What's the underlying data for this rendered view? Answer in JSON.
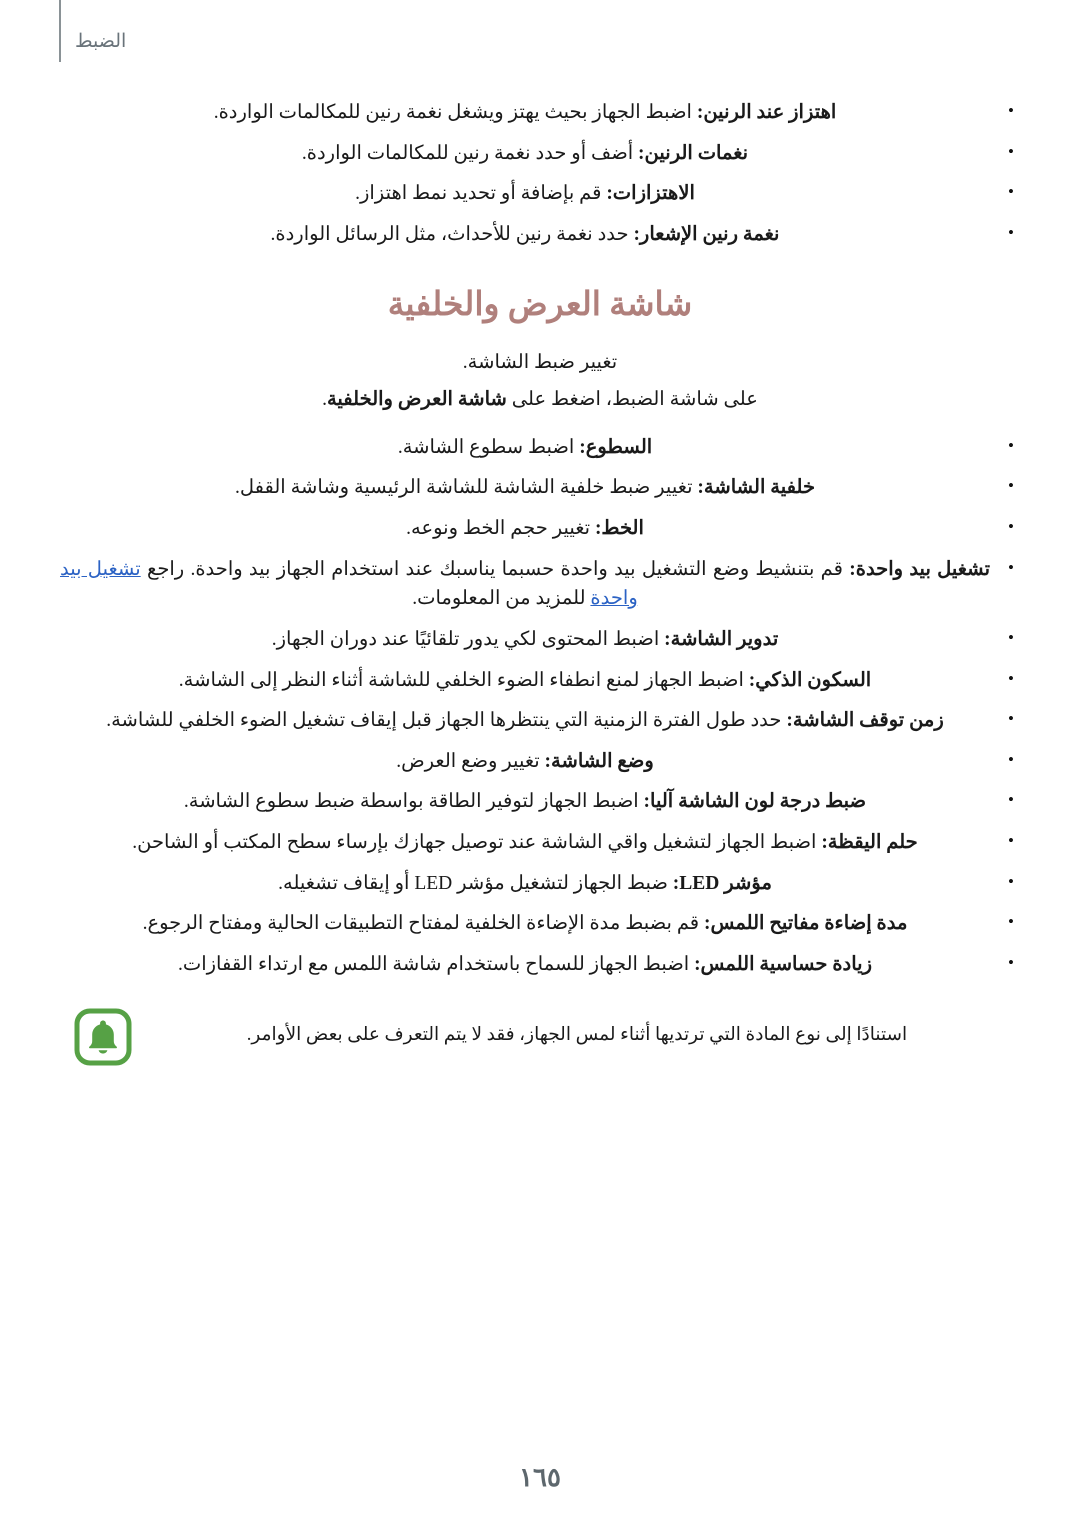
{
  "header": {
    "title": "الضبط",
    "rule_color": "#8a9296",
    "title_color": "#69737a"
  },
  "colors": {
    "heading": "#b0807c",
    "link": "#2b62c4",
    "note_icon": "#56a145",
    "body_text": "#1a1a1a",
    "page_number": "#5d676d"
  },
  "top_list": {
    "items": [
      {
        "term": "اهتزاز عند الرنين:",
        "description": " اضبط الجهاز بحيث يهتز ويشغل نغمة رنين للمكالمات الواردة."
      },
      {
        "term": "نغمات الرنين:",
        "description": " أضف أو حدد نغمة رنين للمكالمات الواردة."
      },
      {
        "term": "الاهتزازات:",
        "description": " قم بإضافة أو تحديد نمط اهتزاز."
      },
      {
        "term": "نغمة رنين الإشعار:",
        "description": " حدد نغمة رنين للأحداث، مثل الرسائل الواردة."
      }
    ]
  },
  "section": {
    "heading": "شاشة العرض والخلفية",
    "intro": "تغيير ضبط الشاشة.",
    "nav_prefix": "على شاشة الضبط، اضغط على ",
    "nav_target": "شاشة العرض والخلفية",
    "nav_suffix": "."
  },
  "main_list": {
    "items": [
      {
        "term": "السطوع:",
        "description": " اضبط سطوع الشاشة."
      },
      {
        "term": "خلفية الشاشة:",
        "description": " تغيير ضبط خلفية الشاشة للشاشة الرئيسية وشاشة القفل."
      },
      {
        "term": "الخط:",
        "description": " تغيير حجم الخط ونوعه."
      },
      {
        "term": "تشغيل بيد واحدة:",
        "description": " قم بتنشيط وضع التشغيل بيد واحدة حسبما يناسبك عند استخدام الجهاز بيد واحدة. راجع ",
        "link_text": "تشغيل بيد واحدة",
        "description_tail": " للمزيد من المعلومات."
      },
      {
        "term": "تدوير الشاشة:",
        "description": " اضبط المحتوى لكي يدور تلقائيًا عند دوران الجهاز."
      },
      {
        "term": "السكون الذكي:",
        "description": " اضبط الجهاز لمنع انطفاء الضوء الخلفي للشاشة أثناء النظر إلى الشاشة."
      },
      {
        "term": "زمن توقف الشاشة:",
        "description": " حدد طول الفترة الزمنية التي ينتظرها الجهاز قبل إيقاف تشغيل الضوء الخلفي للشاشة."
      },
      {
        "term": "وضع الشاشة:",
        "description": " تغيير وضع العرض."
      },
      {
        "term": "ضبط درجة لون الشاشة آليا:",
        "description": " اضبط الجهاز لتوفير الطاقة بواسطة ضبط سطوع الشاشة."
      },
      {
        "term": "حلم اليقظة:",
        "description": " اضبط الجهاز لتشغيل واقي الشاشة عند توصيل جهازك بإرساء سطح المكتب أو الشاحن."
      },
      {
        "term": "مؤشر LED:",
        "description": " ضبط الجهاز لتشغيل مؤشر LED أو إيقاف تشغيله."
      },
      {
        "term": "مدة إضاءة مفاتيح اللمس:",
        "description": " قم بضبط مدة الإضاءة الخلفية لمفتاح التطبيقات الحالية ومفتاح الرجوع."
      },
      {
        "term": "زيادة حساسية اللمس:",
        "description": " اضبط الجهاز للسماح باستخدام شاشة اللمس مع ارتداء القفازات."
      }
    ]
  },
  "note": {
    "icon_name": "bell-icon",
    "text": "استنادًا إلى نوع المادة التي ترتديها أثناء لمس الجهاز، فقد لا يتم التعرف على بعض الأوامر."
  },
  "footer": {
    "page_number": "١٦٥"
  }
}
